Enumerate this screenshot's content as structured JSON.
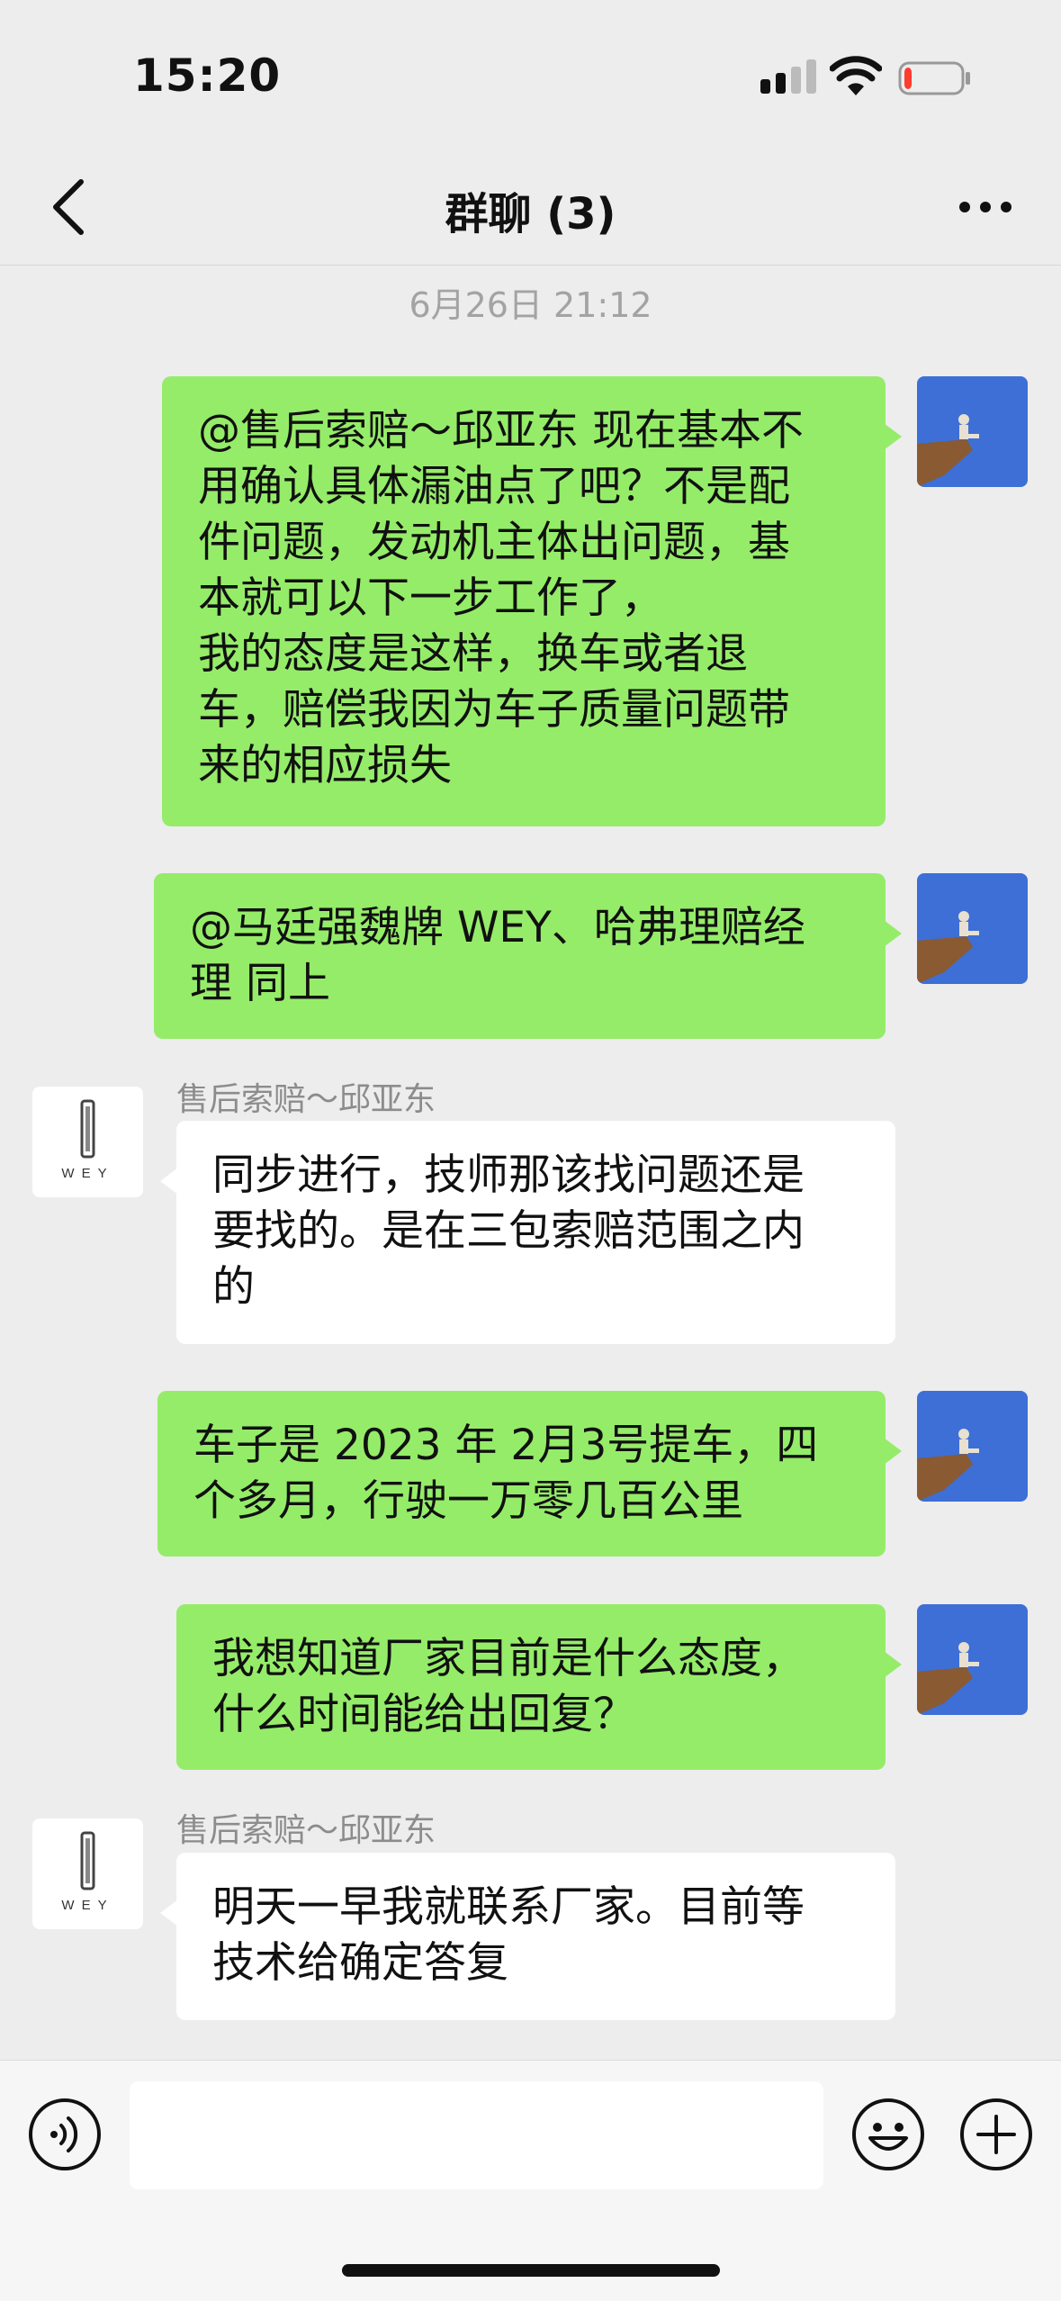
{
  "status_bar": {
    "time": "15:20",
    "battery_level": 0.12
  },
  "header": {
    "title": "群聊 (3)"
  },
  "timestamp": "6月26日 21:12",
  "messages": [
    {
      "side": "self",
      "text": "@售后索赔～邱亚东 现在基本不\n用确认具体漏油点了吧？不是配\n件问题，发动机主体出问题，基\n本就可以下一步工作了，\n我的态度是这样，换车或者退\n车，赔偿我因为车子质量问题带\n来的相应损失"
    },
    {
      "side": "self",
      "text": "@马廷强魏牌 WEY、哈弗理赔经\n理 同上"
    },
    {
      "side": "other",
      "sender": "售后索赔～邱亚东",
      "avatar_text": "WEY",
      "text": "同步进行，技师那该找问题还是\n要找的。是在三包索赔范围之内\n的"
    },
    {
      "side": "self",
      "text": "车子是 2023 年 2月3号提车，四\n个多月，行驶一万零几百公里"
    },
    {
      "side": "self",
      "text": "我想知道厂家目前是什么态度，\n什么时间能给出回复？"
    },
    {
      "side": "other",
      "sender": "售后索赔～邱亚东",
      "avatar_text": "WEY",
      "text": "明天一早我就联系厂家。目前等\n技术给确定答复"
    }
  ],
  "input_bar": {
    "value": ""
  },
  "colors": {
    "self_bubble": "#95ec69",
    "other_bubble": "#ffffff",
    "background": "#ededed"
  },
  "icons": [
    "back-arrow-icon",
    "more-dots-icon",
    "signal-icon",
    "wifi-icon",
    "battery-icon",
    "voice-icon",
    "emoji-icon",
    "plus-icon"
  ]
}
